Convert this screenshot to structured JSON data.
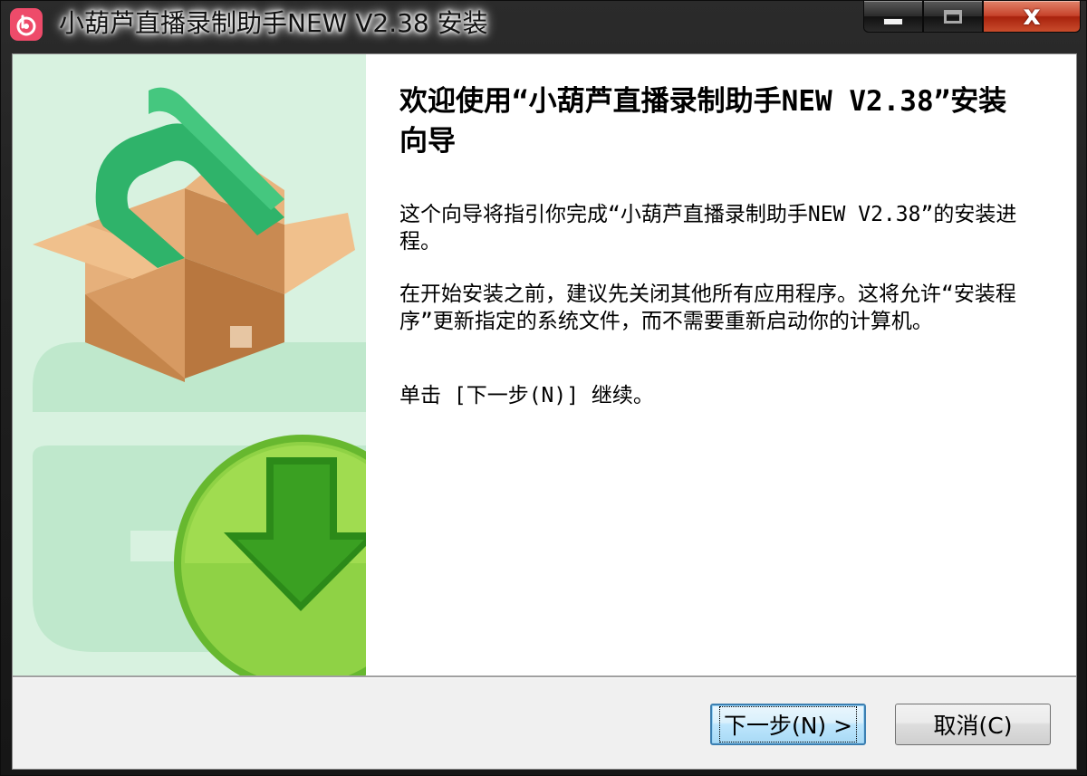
{
  "window": {
    "title": "小葫芦直播录制助手NEW V2.38 安装"
  },
  "titlebar": {
    "app_icon": "hulu-app-icon",
    "minimize_icon": "minimize-icon",
    "maximize_icon": "maximize-icon",
    "close_label": "x"
  },
  "content": {
    "heading": "欢迎使用“小葫芦直播录制助手NEW V2.38”安装向导",
    "paragraph1": "这个向导将指引你完成“小葫芦直播录制助手NEW V2.38”的安装进程。",
    "paragraph2": "在开始安装之前，建议先关闭其他所有应用程序。这将允许“安装程序”更新指定的系统文件，而不需要重新启动你的计算机。",
    "paragraph3": "单击 [下一步(N)] 继续。"
  },
  "side_panel": {
    "box_icon": "package-box-icon",
    "download_icon": "download-arrow-icon"
  },
  "buttons": {
    "next_label": "下一步(N) >",
    "cancel_label": "取消(C)"
  },
  "colors": {
    "side_panel_bg": "#d8f2e0",
    "accent_green": "#2fb36a",
    "close_red": "#c7432b",
    "focus_blue": "#3c7fb1"
  }
}
